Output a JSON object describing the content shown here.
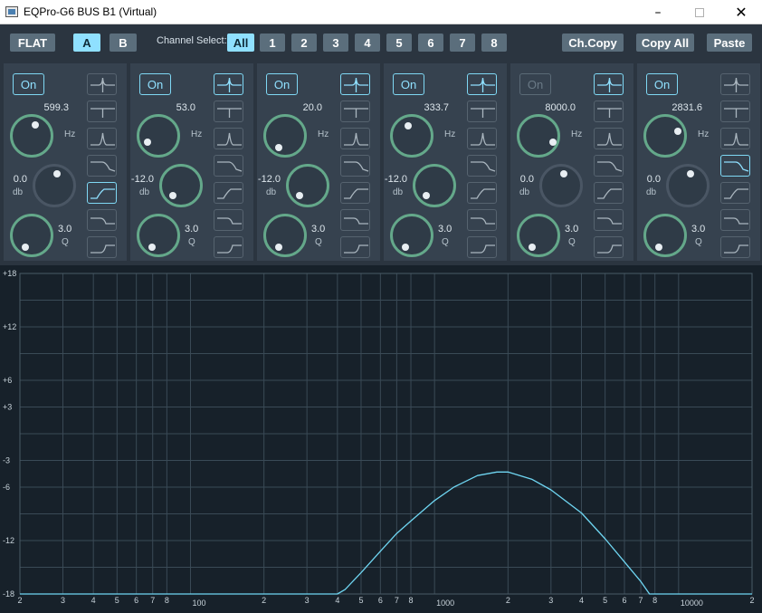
{
  "window": {
    "title": "EQPro-G6 BUS B1 (Virtual)",
    "controls": [
      "minimize",
      "maximize",
      "close"
    ]
  },
  "toolbar": {
    "flat": "FLAT",
    "a": "A",
    "b": "B",
    "channel_select_label": "Channel Select:",
    "channels": [
      "All",
      "1",
      "2",
      "3",
      "4",
      "5",
      "6",
      "7",
      "8"
    ],
    "active_channel": "All",
    "active_preset": "A",
    "ch_copy": "Ch.Copy",
    "copy_all": "Copy All",
    "paste": "Paste"
  },
  "labels": {
    "hz": "Hz",
    "db": "db",
    "q": "Q"
  },
  "bands": [
    {
      "on_label": "On",
      "enabled": true,
      "freq": "599.3",
      "gain": "0.0",
      "q": "3.0",
      "active_filter": 4
    },
    {
      "on_label": "On",
      "enabled": true,
      "freq": "53.0",
      "gain": "-12.0",
      "q": "3.0",
      "active_filter": 0
    },
    {
      "on_label": "On",
      "enabled": true,
      "freq": "20.0",
      "gain": "-12.0",
      "q": "3.0",
      "active_filter": 0
    },
    {
      "on_label": "On",
      "enabled": true,
      "freq": "333.7",
      "gain": "-12.0",
      "q": "3.0",
      "active_filter": 0
    },
    {
      "on_label": "On",
      "enabled": false,
      "freq": "8000.0",
      "gain": "0.0",
      "q": "3.0",
      "active_filter": 0
    },
    {
      "on_label": "On",
      "enabled": true,
      "freq": "2831.6",
      "gain": "0.0",
      "q": "3.0",
      "active_filter": 3
    }
  ],
  "filter_types": [
    "notch-icon",
    "low-shelf-icon",
    "peak-icon",
    "high-cut-icon",
    "low-cut-icon",
    "high-shelf-step-icon",
    "low-shelf-step-icon"
  ],
  "graph": {
    "y_ticks": [
      "+18",
      "+12",
      "+6",
      "+3",
      "-3",
      "-6",
      "-12",
      "-18"
    ],
    "x_ticks": [
      "2",
      "3",
      "4",
      "5",
      "6",
      "7",
      "8",
      "100",
      "2",
      "3",
      "4",
      "5",
      "6",
      "7",
      "8",
      "1000",
      "2",
      "3",
      "4",
      "5",
      "6",
      "7",
      "8",
      "10000",
      "2"
    ],
    "response_db": {
      "hz": [
        20,
        400,
        430,
        500,
        600,
        700,
        800,
        1000,
        1200,
        1500,
        1800,
        2000,
        2500,
        3000,
        4000,
        5000,
        6000,
        7000,
        7600,
        8000,
        20000
      ],
      "db": [
        -18,
        -18,
        -17.5,
        -15.6,
        -13.2,
        -11.2,
        -9.8,
        -7.5,
        -6,
        -4.7,
        -4.3,
        -4.3,
        -5.1,
        -6.3,
        -8.9,
        -11.8,
        -14.4,
        -16.6,
        -18,
        -18,
        -18
      ]
    },
    "colors": {
      "curve": "#6fd6f2",
      "grid": "#3a4a56",
      "background": "#17212a"
    }
  }
}
